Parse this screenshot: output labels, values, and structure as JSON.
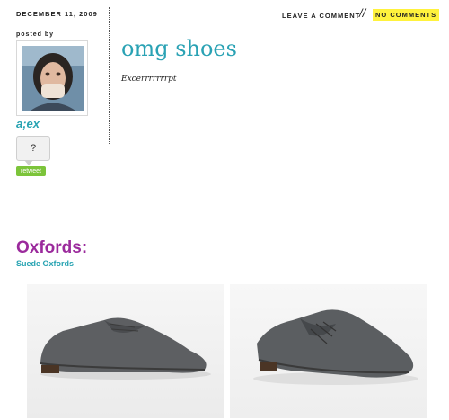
{
  "post": {
    "date": "DECEMBER 11, 2009",
    "posted_by": "posted by",
    "author": "a;ex",
    "comment_count": "?",
    "retweet_label": "retweet",
    "title": "omg shoes",
    "excerpt": "Excerrrrrrrpt",
    "leave_comment": "LEAVE A COMMENT",
    "separator": "//",
    "no_comments": "NO COMMENTS"
  },
  "content": {
    "heading": "Oxfords:",
    "link": "Suede Oxfords",
    "images": [
      {
        "icon": "shoe-photo"
      },
      {
        "icon": "shoe-photo"
      }
    ]
  },
  "colors": {
    "title": "#2aa2b4",
    "heading": "#9b2a9c",
    "retweet": "#7cc43a",
    "highlight": "#fff23d"
  }
}
